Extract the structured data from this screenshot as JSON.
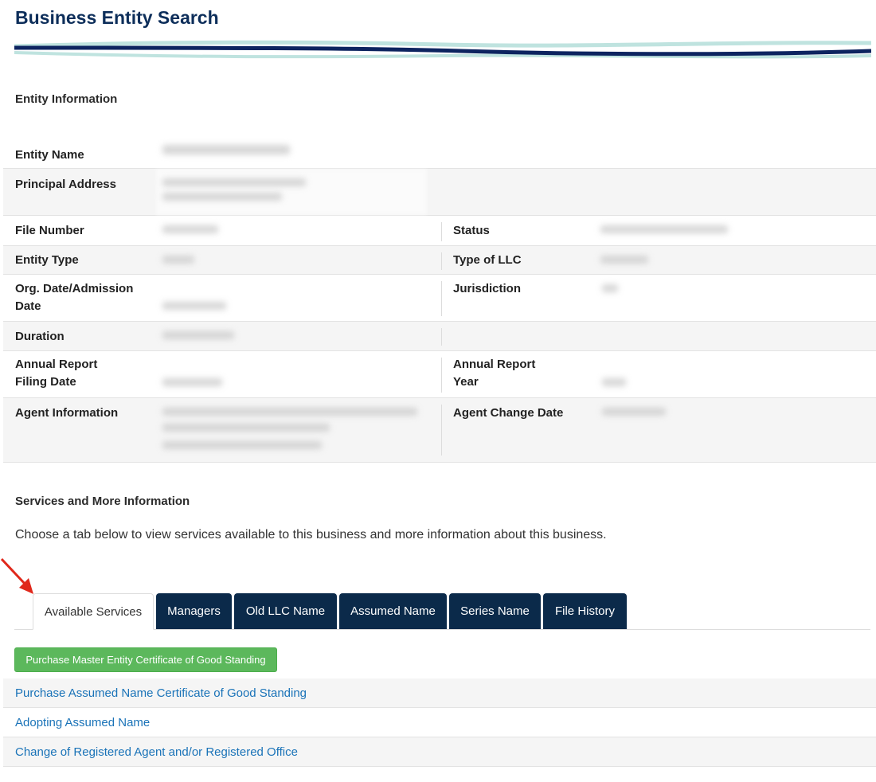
{
  "page": {
    "title": "Business Entity Search"
  },
  "entity_info": {
    "heading": "Entity Information",
    "rows": [
      {
        "left_label": "Entity Name"
      },
      {
        "left_label": "Principal Address"
      },
      {
        "left_label": "File Number",
        "right_label": "Status"
      },
      {
        "left_label": "Entity Type",
        "right_label": "Type of LLC"
      },
      {
        "left_label": "Org. Date/Admission Date",
        "right_label": "Jurisdiction"
      },
      {
        "left_label": "Duration"
      },
      {
        "left_label_line1": "Annual Report",
        "left_label_line2": "Filing Date",
        "right_label_line1": "Annual Report",
        "right_label_line2": "Year"
      },
      {
        "left_label": "Agent Information",
        "right_label": "Agent Change Date"
      }
    ]
  },
  "services": {
    "heading": "Services and More Information",
    "description": "Choose a tab below to view services available to this business and more information about this business.",
    "tabs": [
      {
        "label": "Available Services",
        "active": true
      },
      {
        "label": "Managers"
      },
      {
        "label": "Old LLC Name"
      },
      {
        "label": "Assumed Name"
      },
      {
        "label": "Series Name"
      },
      {
        "label": "File History"
      }
    ],
    "primary_button": "Purchase Master Entity Certificate of Good Standing",
    "links": [
      "Purchase Assumed Name Certificate of Good Standing",
      "Adopting Assumed Name",
      "Change of Registered Agent and/or Registered Office"
    ]
  },
  "colors": {
    "title": "#0d2e5a",
    "tab_dark": "#0b2a4a",
    "button_green": "#5cb85c",
    "link": "#1a73b8",
    "wave_light": "#bfe3df",
    "wave_dark": "#0d2460",
    "annotation_arrow": "#e0281b"
  },
  "icons": {
    "annotation": "red-arrow-icon"
  }
}
